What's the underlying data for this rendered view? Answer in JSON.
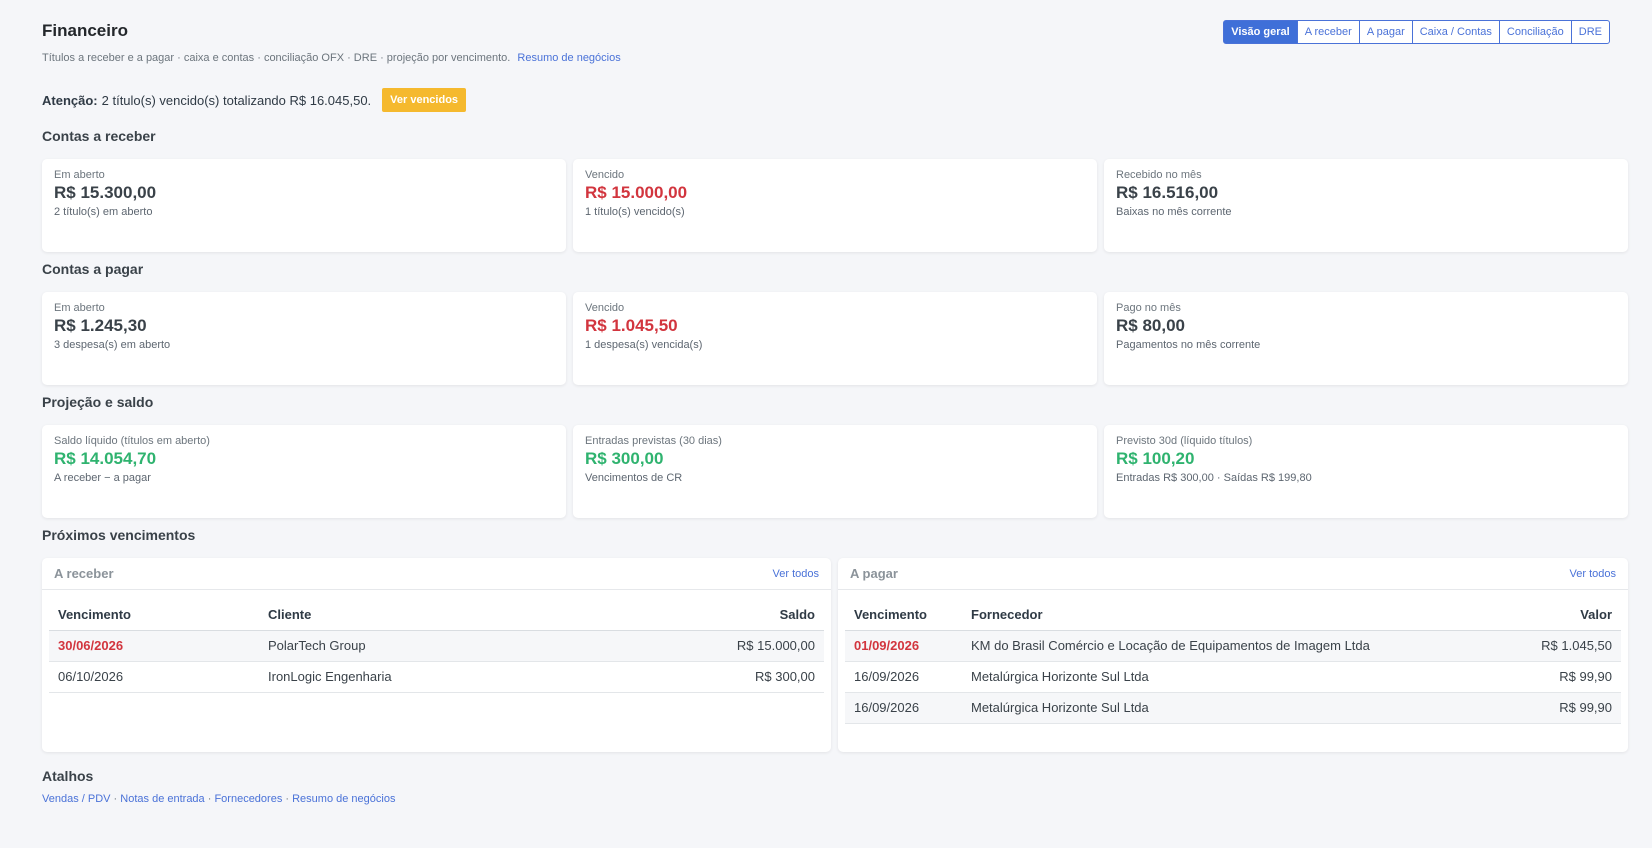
{
  "header": {
    "title": "Financeiro",
    "subtitle": "Títulos a receber e a pagar · caixa e contas · conciliação OFX · DRE · projeção por vencimento.",
    "subtitle_link": "Resumo de negócios"
  },
  "tabs": [
    {
      "label": "Visão geral",
      "active": true
    },
    {
      "label": "A receber",
      "active": false
    },
    {
      "label": "A pagar",
      "active": false
    },
    {
      "label": "Caixa / Contas",
      "active": false
    },
    {
      "label": "Conciliação",
      "active": false
    },
    {
      "label": "DRE",
      "active": false
    }
  ],
  "alert": {
    "label": "Atenção:",
    "message": "2 título(s) vencido(s) totalizando R$ 16.045,50.",
    "button": "Ver vencidos"
  },
  "receber": {
    "title": "Contas a receber",
    "cards": [
      {
        "label": "Em aberto",
        "value": "R$ 15.300,00",
        "sub": "2 título(s) em aberto",
        "tone": "neutral"
      },
      {
        "label": "Vencido",
        "value": "R$ 15.000,00",
        "sub": "1 título(s) vencido(s)",
        "tone": "red"
      },
      {
        "label": "Recebido no mês",
        "value": "R$ 16.516,00",
        "sub": "Baixas no mês corrente",
        "tone": "neutral"
      }
    ]
  },
  "pagar": {
    "title": "Contas a pagar",
    "cards": [
      {
        "label": "Em aberto",
        "value": "R$ 1.245,30",
        "sub": "3 despesa(s) em aberto",
        "tone": "neutral"
      },
      {
        "label": "Vencido",
        "value": "R$ 1.045,50",
        "sub": "1 despesa(s) vencida(s)",
        "tone": "red"
      },
      {
        "label": "Pago no mês",
        "value": "R$ 80,00",
        "sub": "Pagamentos no mês corrente",
        "tone": "neutral"
      }
    ]
  },
  "projecao": {
    "title": "Projeção e saldo",
    "cards": [
      {
        "label": "Saldo líquido (títulos em aberto)",
        "value": "R$ 14.054,70",
        "sub": "A receber − a pagar",
        "tone": "green"
      },
      {
        "label": "Entradas previstas (30 dias)",
        "value": "R$ 300,00",
        "sub": "Vencimentos de CR",
        "tone": "green"
      },
      {
        "label": "Previsto 30d (líquido títulos)",
        "value": "R$ 100,20",
        "sub": "Entradas R$ 300,00 · Saídas R$ 199,80",
        "tone": "green"
      }
    ]
  },
  "proximos": {
    "title": "Próximos vencimentos",
    "receber": {
      "title": "A receber",
      "link": "Ver todos",
      "columns": [
        "Vencimento",
        "Cliente",
        "Saldo"
      ],
      "rows": [
        {
          "date": "30/06/2026",
          "name": "PolarTech Group",
          "value": "R$ 15.000,00",
          "overdue": true
        },
        {
          "date": "06/10/2026",
          "name": "IronLogic Engenharia",
          "value": "R$ 300,00",
          "overdue": false
        }
      ]
    },
    "pagar": {
      "title": "A pagar",
      "link": "Ver todos",
      "columns": [
        "Vencimento",
        "Fornecedor",
        "Valor"
      ],
      "rows": [
        {
          "date": "01/09/2026",
          "name": "KM do Brasil Comércio e Locação de Equipamentos de Imagem Ltda",
          "value": "R$ 1.045,50",
          "overdue": true
        },
        {
          "date": "16/09/2026",
          "name": "Metalúrgica Horizonte Sul Ltda",
          "value": "R$ 99,90",
          "overdue": false
        },
        {
          "date": "16/09/2026",
          "name": "Metalúrgica Horizonte Sul Ltda",
          "value": "R$ 99,90",
          "overdue": false
        }
      ]
    }
  },
  "atalhos": {
    "title": "Atalhos",
    "links": [
      "Vendas / PDV",
      "Notas de entrada",
      "Fornecedores",
      "Resumo de negócios"
    ],
    "separator": " · "
  },
  "colors": {
    "accent": "#3f6fd8",
    "danger": "#d2353e",
    "success": "#2fb36f",
    "warning": "#f5b92e"
  }
}
